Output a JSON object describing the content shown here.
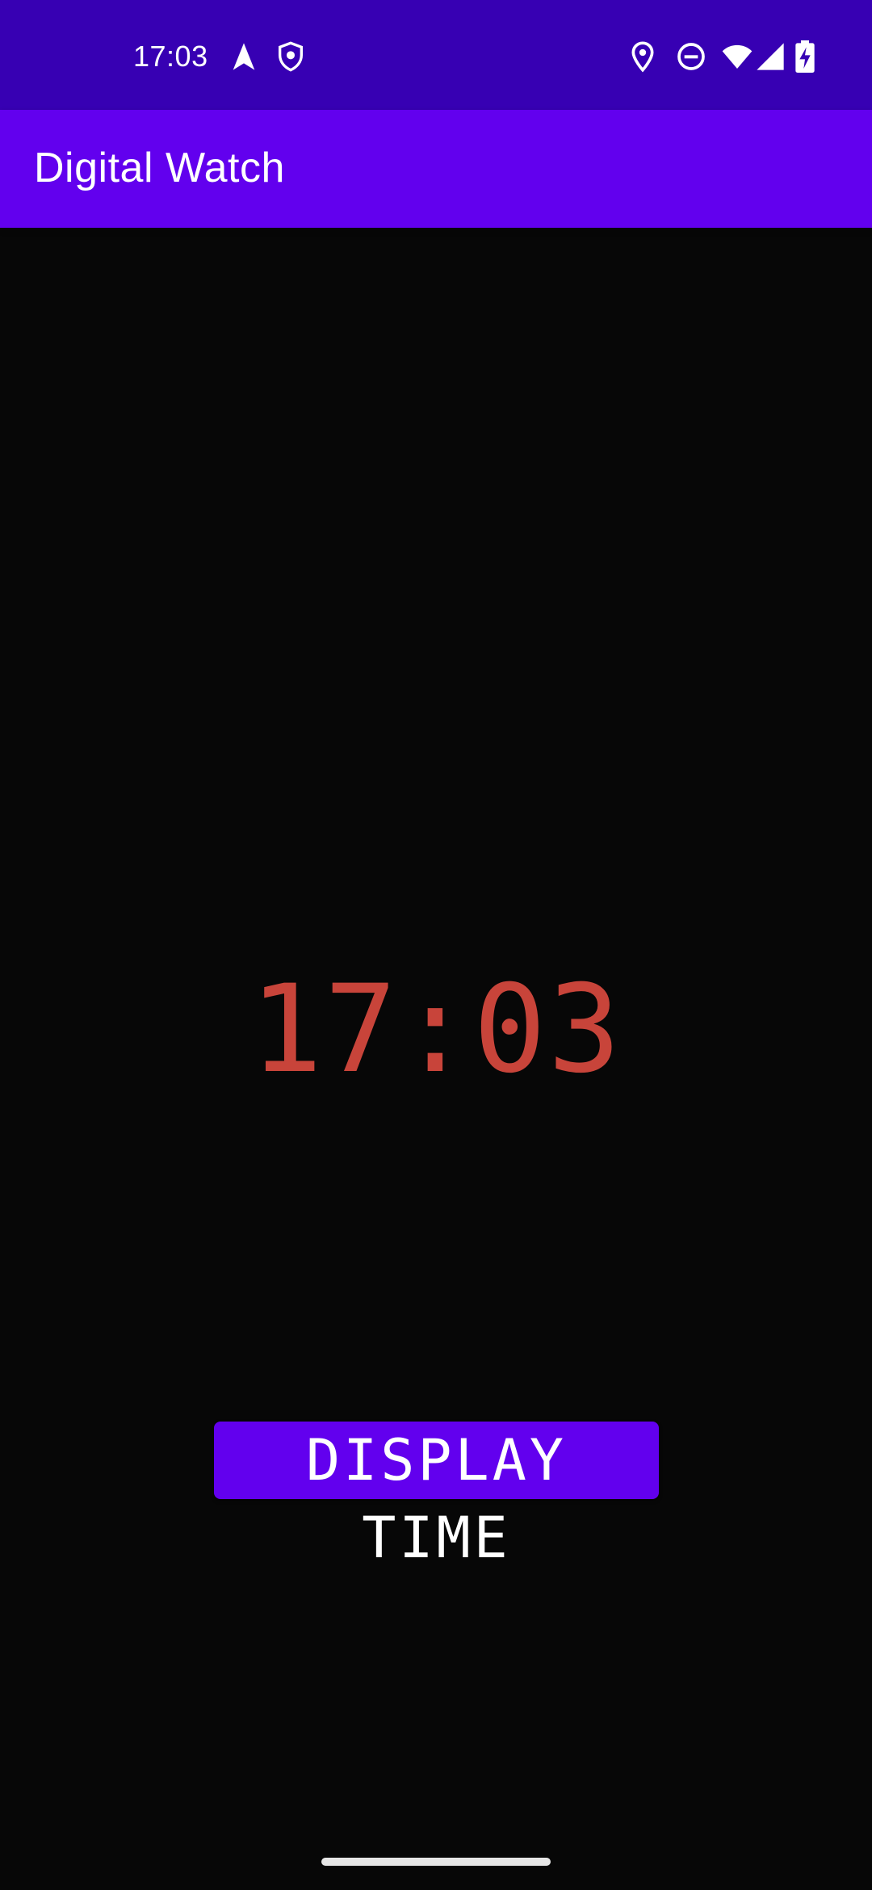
{
  "status_bar": {
    "time": "17:03",
    "icons": [
      "navigation-arrow-icon",
      "shield-icon",
      "location-pin-icon",
      "do-not-disturb-icon",
      "wifi-icon",
      "cellular-signal-icon",
      "battery-charging-icon"
    ]
  },
  "app_bar": {
    "title": "Digital Watch"
  },
  "clock": {
    "time": "17:03",
    "color": "#c8443a"
  },
  "button": {
    "label": "DISPLAY TIME",
    "color": "#6200ee"
  },
  "colors": {
    "status_bar": "#3700b3",
    "app_bar": "#6200ee",
    "background": "#070707"
  }
}
